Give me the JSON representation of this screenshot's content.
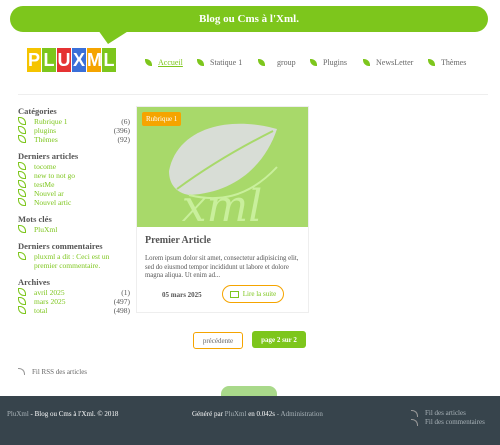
{
  "header": {
    "title": "Blog ou Cms à l'Xml."
  },
  "logo": {
    "letters": [
      {
        "char": "P",
        "color": "#f5c400"
      },
      {
        "char": "L",
        "color": "#7dc61c"
      },
      {
        "char": "U",
        "color": "#e53232"
      },
      {
        "char": "X",
        "color": "#3a6fd8"
      },
      {
        "char": "M",
        "color": "#f5a400"
      },
      {
        "char": "L",
        "color": "#7dc61c"
      }
    ]
  },
  "nav": {
    "items": [
      {
        "label": "Accueil"
      },
      {
        "label": "Statique 1"
      },
      {
        "label": "group"
      },
      {
        "label": "Plugins"
      },
      {
        "label": "NewsLetter"
      },
      {
        "label": "Thèmes"
      }
    ]
  },
  "sidebar": {
    "categories": {
      "title": "Catégories",
      "items": [
        {
          "label": "Rubrique 1",
          "count": "(6)"
        },
        {
          "label": "plugins",
          "count": "(396)"
        },
        {
          "label": "Thèmes",
          "count": "(92)"
        }
      ]
    },
    "recent_articles": {
      "title": "Derniers articles",
      "items": [
        "tocome",
        "new to not go",
        "testMe",
        "Nouvel ar",
        "Nouvel artic"
      ]
    },
    "tags": {
      "title": "Mots clés",
      "items": [
        "PluXml"
      ]
    },
    "recent_comments": {
      "title": "Derniers commentaires",
      "items": [
        "pluxml a dit : Ceci est un premier commentaire."
      ]
    },
    "archives": {
      "title": "Archives",
      "items": [
        {
          "label": "avril 2025",
          "count": "(1)"
        },
        {
          "label": "mars 2025",
          "count": "(497)"
        },
        {
          "label": "total",
          "count": "(498)"
        }
      ]
    }
  },
  "article": {
    "category": "Rubrique 1",
    "image_text": "xml",
    "title": "Premier Article",
    "excerpt": "Lorem ipsum dolor sit amet, consectetur adipisicing elit, sed do eiusmod tempor incididunt ut labore et dolore magna aliqua. Ut enim ad...",
    "date": "05 mars 2025",
    "read_more": "Lire la suite"
  },
  "pagination": {
    "prev": "précédente",
    "current": "page 2 sur 2"
  },
  "rss": {
    "label": "Fil RSS des articles"
  },
  "footer": {
    "brand": "PluXml",
    "copyright": " - Blog ou Cms à l'Xml. © 2018",
    "generated_prefix": "Généré par ",
    "generated_brand": "PluXml",
    "generated_suffix": " en 0.042s",
    "separator": "-",
    "admin": "Administration",
    "feed_articles": "Fil des articles",
    "feed_comments": "Fil des commentaires"
  }
}
